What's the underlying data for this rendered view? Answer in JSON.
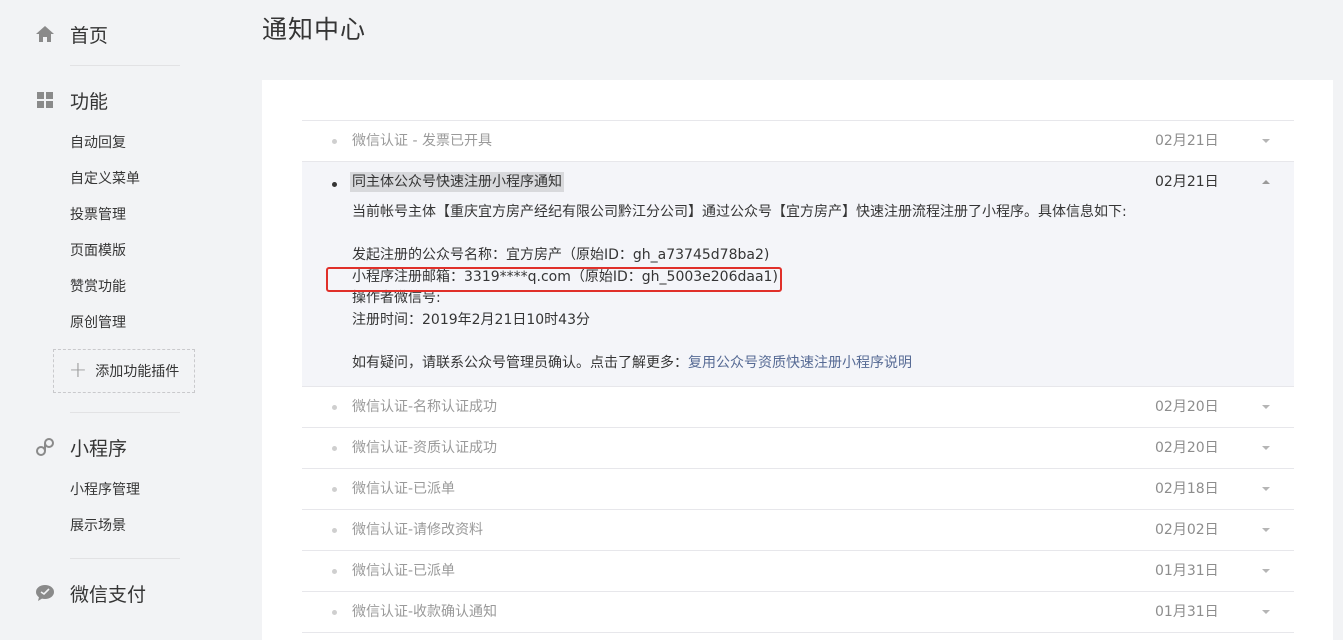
{
  "sidebar": {
    "home": {
      "label": "首页",
      "icon": "home-icon"
    },
    "features": {
      "label": "功能",
      "icon": "grid-icon",
      "items": [
        "自动回复",
        "自定义菜单",
        "投票管理",
        "页面模版",
        "赞赏功能",
        "原创管理"
      ],
      "add_plugin_label": "添加功能插件"
    },
    "miniprogram": {
      "label": "小程序",
      "icon": "link-icon",
      "items": [
        "小程序管理",
        "展示场景"
      ]
    },
    "wechatpay": {
      "label": "微信支付",
      "icon": "chat-bubble-icon"
    }
  },
  "main": {
    "title": "通知中心",
    "notifications": [
      {
        "title": "微信认证 - 发票已开具",
        "date": "02月21日",
        "expanded": false
      },
      {
        "title": "同主体公众号快速注册小程序通知",
        "date": "02月21日",
        "expanded": true,
        "detail": {
          "intro": "当前帐号主体【重庆宜方房产经纪有限公司黔江分公司】通过公众号【宜方房产】快速注册流程注册了小程序。具体信息如下:",
          "account_line": "发起注册的公众号名称：宜方房产（原始ID：gh_a73745d78ba2)",
          "email_line": "小程序注册邮箱：3319****q.com（原始ID：gh_5003e206daa1)",
          "operator_line": "操作者微信号:",
          "time_line": "注册时间：2019年2月21日10时43分",
          "help_text": "如有疑问，请联系公众号管理员确认。点击了解更多：",
          "help_link": "复用公众号资质快速注册小程序说明"
        }
      },
      {
        "title": "微信认证-名称认证成功",
        "date": "02月20日",
        "expanded": false
      },
      {
        "title": "微信认证-资质认证成功",
        "date": "02月20日",
        "expanded": false
      },
      {
        "title": "微信认证-已派单",
        "date": "02月18日",
        "expanded": false
      },
      {
        "title": "微信认证-请修改资料",
        "date": "02月02日",
        "expanded": false
      },
      {
        "title": "微信认证-已派单",
        "date": "01月31日",
        "expanded": false
      },
      {
        "title": "微信认证-收款确认通知",
        "date": "01月31日",
        "expanded": false
      }
    ]
  },
  "colors": {
    "link": "#576b95",
    "highlight_border": "#e0302a",
    "expanded_bg": "#f4f5f9"
  }
}
